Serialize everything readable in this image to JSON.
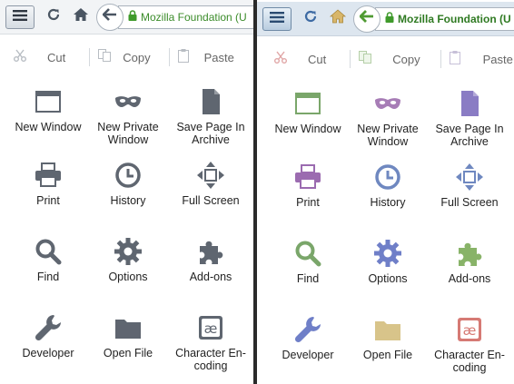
{
  "panels": [
    {
      "url": "Mozilla Foundation (U",
      "edit": {
        "cut": "Cut",
        "copy": "Copy",
        "paste": "Paste"
      },
      "items": [
        {
          "label": "New Window",
          "icon": "new-window-icon"
        },
        {
          "label": "New Private Window",
          "icon": "private-mask-icon"
        },
        {
          "label": "Save Page In Archive",
          "icon": "save-page-icon"
        },
        {
          "label": "Print",
          "icon": "printer-icon"
        },
        {
          "label": "History",
          "icon": "clock-icon"
        },
        {
          "label": "Full Screen",
          "icon": "fullscreen-icon"
        },
        {
          "label": "Find",
          "icon": "magnifier-icon"
        },
        {
          "label": "Options",
          "icon": "gear-icon"
        },
        {
          "label": "Add-ons",
          "icon": "puzzle-icon"
        },
        {
          "label": "Developer",
          "icon": "wrench-icon"
        },
        {
          "label": "Open File",
          "icon": "folder-icon"
        },
        {
          "label": "Character En-coding",
          "icon": "character-encoding-icon"
        }
      ]
    },
    {
      "url": "Mozilla Foundation (U",
      "edit": {
        "cut": "Cut",
        "copy": "Copy",
        "paste": "Paste"
      },
      "items": [
        {
          "label": "New Window",
          "icon": "new-window-icon"
        },
        {
          "label": "New Private Window",
          "icon": "private-mask-icon"
        },
        {
          "label": "Save Page In Archive",
          "icon": "save-page-icon"
        },
        {
          "label": "Print",
          "icon": "printer-icon"
        },
        {
          "label": "History",
          "icon": "clock-icon"
        },
        {
          "label": "Full Screen",
          "icon": "fullscreen-icon"
        },
        {
          "label": "Find",
          "icon": "magnifier-icon"
        },
        {
          "label": "Options",
          "icon": "gear-icon"
        },
        {
          "label": "Add-ons",
          "icon": "puzzle-icon"
        },
        {
          "label": "Developer",
          "icon": "wrench-icon"
        },
        {
          "label": "Open File",
          "icon": "folder-icon"
        },
        {
          "label": "Character En-coding",
          "icon": "character-encoding-icon"
        }
      ]
    }
  ],
  "icon_colors": {
    "monochrome": [
      "#5f6670",
      "#5f6670",
      "#5f6670",
      "#5f6670",
      "#5f6670",
      "#5f6670",
      "#5f6670",
      "#5f6670",
      "#5f6670",
      "#5f6670",
      "#5f6670",
      "#5f6670"
    ],
    "colored": [
      "#7aa66a",
      "#a77db6",
      "#8a7cc4",
      "#9b6bb0",
      "#6f88c0",
      "#6f88c0",
      "#7aa66a",
      "#6f7fc8",
      "#88b368",
      "#6f7fc8",
      "#d8c48a",
      "#d67a74"
    ]
  }
}
